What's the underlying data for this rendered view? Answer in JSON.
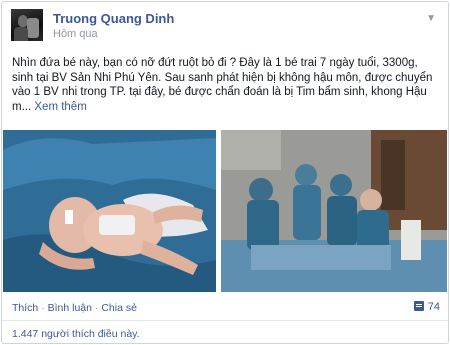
{
  "post": {
    "author": "Truong Quang Dinh",
    "time": "Hôm qua",
    "text": "Nhìn đứa bé này, bạn có nỡ đứt ruột bỏ đi ? Đây là 1 bé trai 7 ngày tuổi, 3300g, sinh tại BV Sản Nhi Phú Yên. Sau sanh phát hiện bị không hậu môn, được chuyển vào 1 BV nhi trong TP. tại đây, bé được chẩn đoán là bị Tim bẩm sinh, khong Hậu m...",
    "see_more": "Xem thêm"
  },
  "actions": {
    "like": "Thích",
    "comment": "Bình luận",
    "share": "Chia sẻ",
    "separator": "·",
    "share_count": "74"
  },
  "likes_text": "1.447 người thích điều này.",
  "icons": {
    "menu": "chevron-down-icon",
    "shares": "share-count-icon"
  },
  "colors": {
    "link": "#3b5998",
    "muted": "#9197a3",
    "text": "#141823"
  }
}
